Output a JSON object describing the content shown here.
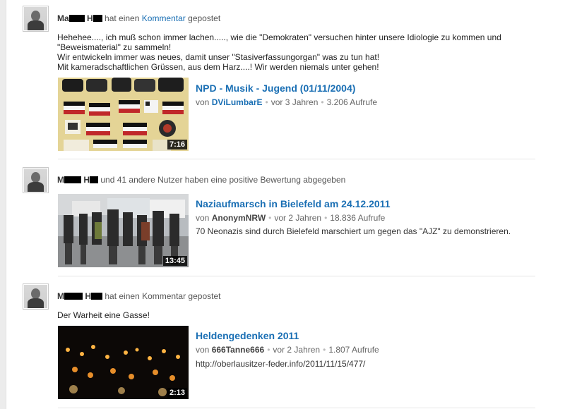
{
  "feed": [
    {
      "user_a": "Ma",
      "user_b": "H",
      "user_c": "",
      "action_text": "hat einen",
      "action_link": "Kommentar",
      "action_suffix": "gepostet",
      "comment": [
        "Hehehee...., ich muß schon immer lachen....., wie die \"Demokraten\" versuchen hinter unsere Idiologie zu kommen und",
        "\"Beweismaterial\" zu sammeln!",
        "Wir entwickeln immer was neues, damit unser \"Stasiverfassungorgan\" was zu tun hat!",
        "Mit kameradschaftlichen Grüssen, aus dem Harz....! Wir werden niemals unter gehen!"
      ],
      "video": {
        "title": "NPD - Musik - Jugend (01/11/2004)",
        "by": "von",
        "author": "DViLumbarE",
        "age": "vor 3 Jahren",
        "views": "3.206 Aufrufe",
        "duration": "7:16",
        "description": ""
      }
    },
    {
      "user_a": "M",
      "user_b": "H",
      "user_c": "",
      "action_text": "und 41 andere Nutzer haben eine positive Bewertung abgegeben",
      "video": {
        "title": "Naziaufmarsch in Bielefeld am 24.12.2011",
        "by": "von",
        "author": "AnonymNRW",
        "age": "vor 2 Jahren",
        "views": "18.836 Aufrufe",
        "duration": "13:45",
        "description": "70 Neonazis sind durch Bielefeld marschiert um gegen das \"AJZ\" zu demonstrieren."
      }
    },
    {
      "user_a": "M",
      "user_b": "H",
      "user_c": "",
      "action_text": "hat einen Kommentar gepostet",
      "comment": [
        "Der Warheit eine Gasse!"
      ],
      "video": {
        "title": "Heldengedenken 2011",
        "by": "von",
        "author": "666Tanne666",
        "age": "vor 2 Jahren",
        "views": "1.807 Aufrufe",
        "duration": "2:13",
        "description": "http://oberlausitzer-feder.info/2011/11/15/477/"
      }
    }
  ],
  "colors": {
    "link": "#1a6fb4",
    "separator": "#e5e5e5",
    "duration_bg": "#000000"
  }
}
